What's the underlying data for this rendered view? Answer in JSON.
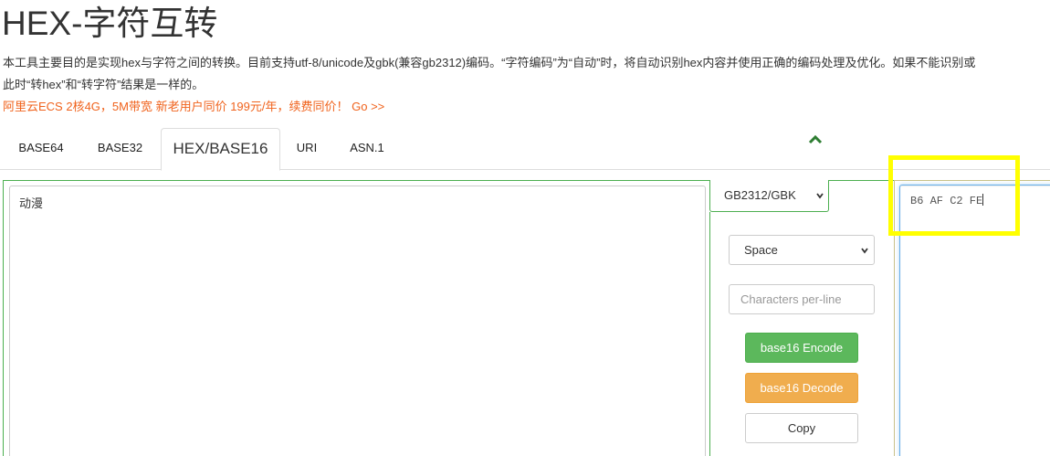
{
  "title": "HEX-字符互转",
  "description_line1": "本工具主要目的是实现hex与字符之间的转换。目前支持utf-8/unicode及gbk(兼容gb2312)编码。“字符编码”为“自动”时，将自动识别hex内容并使用正确的编码处理及优化。如果不能识别或",
  "description_line2": "此时“转hex”和“转字符”结果是一样的。",
  "promo": "阿里云ECS 2核4G，5M带宽 新老用户同价 199元/年，续费同价！ Go >>",
  "tabs": [
    {
      "label": "BASE64"
    },
    {
      "label": "BASE32"
    },
    {
      "label": "HEX/BASE16",
      "active": true
    },
    {
      "label": "URI"
    },
    {
      "label": "ASN.1"
    }
  ],
  "input_text": "动漫",
  "encoding_select": "GB2312/GBK",
  "separator_select": "Space",
  "chars_per_line_placeholder": "Characters per-line",
  "buttons": {
    "encode": "base16 Encode",
    "decode": "base16 Decode",
    "copy": "Copy"
  },
  "output_text": "B6 AF C2 FE",
  "colors": {
    "promo": "#f0631d",
    "encode_button": "#5cb85c",
    "decode_button": "#f0ad4e",
    "panel_border": "#4caf50",
    "highlight": "#ffff00",
    "chevron": "#2e7d32"
  }
}
